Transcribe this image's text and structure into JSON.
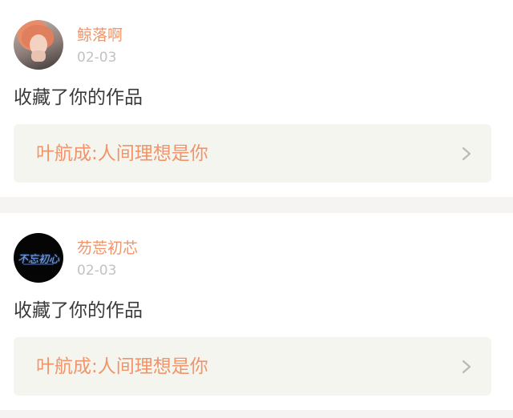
{
  "notifications": [
    {
      "username": "鲸落啊",
      "date": "02-03",
      "message": "收藏了你的作品",
      "work_title": "叶航成:人间理想是你",
      "avatar_icon": "user-photo-avatar"
    },
    {
      "username": "芴莣初芯",
      "date": "02-03",
      "message": "收藏了你的作品",
      "work_title": "叶航成:人间理想是你",
      "avatar_icon": "calligraphy-logo-avatar",
      "avatar_text": "不忘初心"
    }
  ],
  "colors": {
    "accent": "#f0946a",
    "date": "#c2c2c2",
    "message": "#3a3a3a",
    "link_bg": "#f5f5f0",
    "separator": "#f5f4f3"
  }
}
